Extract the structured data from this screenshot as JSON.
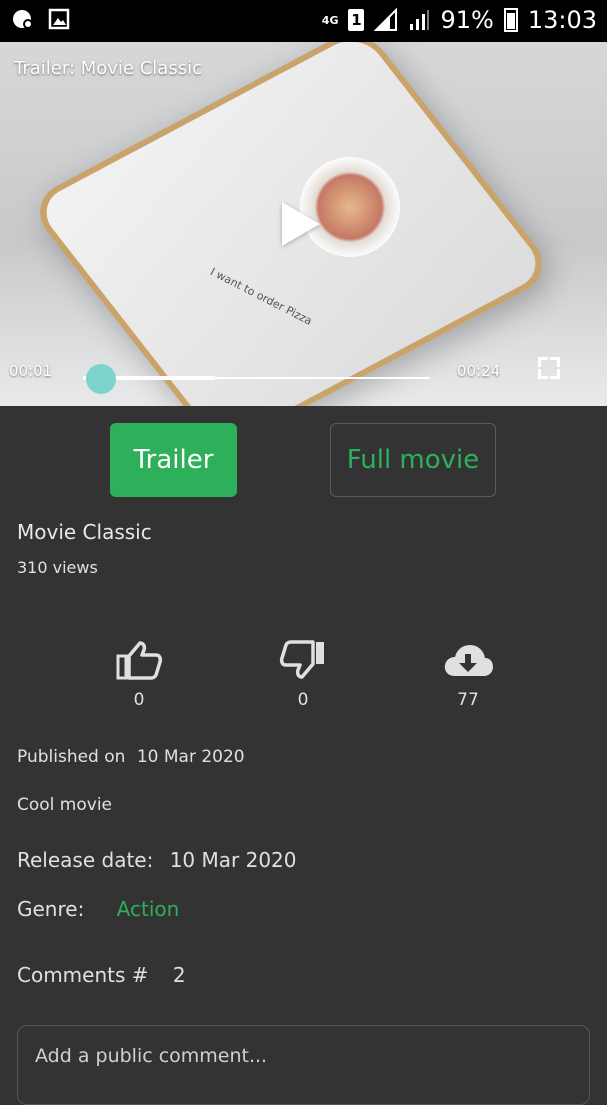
{
  "status_bar": {
    "network": "4G",
    "sim": "1",
    "battery": "91%",
    "time": "13:03"
  },
  "player": {
    "title": "Trailer: Movie Classic",
    "screen_text": "I want to order Pizza",
    "current_time": "00:01",
    "duration": "00:24",
    "progress": 0.04,
    "buffered": 0.38
  },
  "buttons": {
    "trailer": "Trailer",
    "full_movie": "Full movie"
  },
  "movie": {
    "title": "Movie Classic",
    "views": "310 views",
    "published_label": "Published on",
    "published_date": "10 Mar 2020",
    "description": "Cool movie",
    "release_label": "Release date:",
    "release_date": "10 Mar 2020",
    "genre_label": "Genre:",
    "genre": "Action"
  },
  "actions": {
    "likes": "0",
    "dislikes": "0",
    "downloads": "77"
  },
  "comments": {
    "label": "Comments #",
    "count": "2",
    "placeholder": "Add a public comment..."
  },
  "colors": {
    "accent": "#2eaf59",
    "background": "#333333",
    "seek_thumb": "#7ed3cd"
  }
}
